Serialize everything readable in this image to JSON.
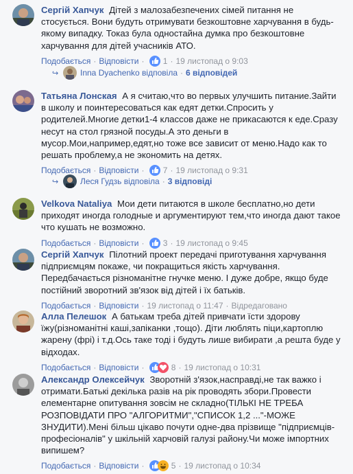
{
  "ui": {
    "like": "Подобається",
    "reply": "Відповісти",
    "edited": "Відредаговано"
  },
  "comments": [
    {
      "author": "Сергій Хапчук",
      "text": "Дітей з малозабезпечених сімей питання не стосується. Вони будуть отримувати безкоштовне харчування в будь-якому випадку. Токаз була одностайна думка про безкоштовне харчування для дітей учасників АТО.",
      "reactions": "1",
      "date": "19 листопад о 9:03",
      "replies": {
        "name": "Inna Dyachenko відповіла",
        "count": "6 відповідей"
      }
    },
    {
      "author": "Татьяна Лонская",
      "text": "А я считаю,что во первых улучшить питание.Зайти в школу и поинтересоваться как едят детки.Спросить у родителей.Многие детки1-4 классов даже не прикасаются к еде.Сразу несут на стол грязной посуды.А это деньги в мусор.Мои,например,едят,но тоже все зависит от меню.Надо как то решать проблему,а не экономить на детях.",
      "reactions": "7",
      "date": "19 листопад о 9:31",
      "replies": {
        "name": "Леся Гудзь відповіла",
        "count": "3 відповіді"
      }
    },
    {
      "author": "Velkova Nataliya",
      "text": "Мои дети питаются в школе бесплатно,но дети приходят иногда голодные и аргументируют тем,что иногда дают такое что кушать не возможно.",
      "reactions": "3",
      "date": "19 листопад о 9:45"
    },
    {
      "author": "Сергій Хапчук",
      "text": "Пілотний проект передачі приготування харчування підприємцям покаже, чи покращиться якість харчування. Передбачається різноманітне гнучке меню. І дуже добре, якщо буде постійний зворотний зв'язок від дітей і їх батьків.",
      "date": "19 листопад о 11:47",
      "edited": true
    },
    {
      "author": "Алла Пелешок",
      "text": "А батькам треба дітей привчати їсти здорову їжу(різноманітні каші,запіканки ,тощо). Діти люблять піци,картоплю жарену (фрі) і т.д.Ось таке тоді і будуть лише вибирати ,а решта буде у відходах.",
      "reactions": "8",
      "date": "19 листопад о 10:31"
    },
    {
      "author": "Александр Олексейчук",
      "text": "Зворотній з'язок,насправді,не так важко і отримати.Батькі декілька разів на рік проводять збори.Провести елементарне опитування зовсім не складно(ТІЛЬКІ НЕ ТРЕБА РОЗПОВІДАТИ ПРО \"АЛГОРИТМИ\",\"СПИСОК 1,2 ...\"-МОЖЕ ЗНУДИТИ).Мені більш цікаво почути одне-два прізвище \"підприємців-професіоналів\" у шкільній харчовій галузі району.Чи може імпортних випишем?",
      "reactions": "5",
      "date": "19 листопад о 10:34"
    }
  ],
  "colors": {
    "background": "#f6f7f9",
    "author": "#385898",
    "link": "#4267b2",
    "meta": "#90949c",
    "like_blue": "#5890ff",
    "heart": "#f25268",
    "haha": "#f7b125"
  }
}
